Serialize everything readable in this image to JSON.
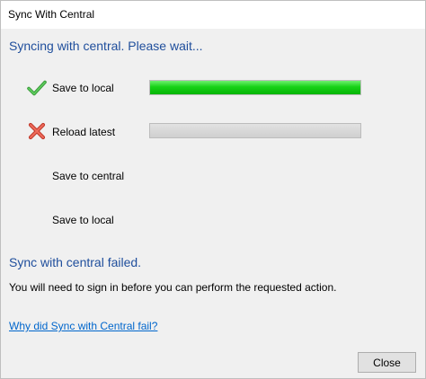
{
  "window": {
    "title": "Sync With Central"
  },
  "status": {
    "heading": "Syncing with central. Please wait..."
  },
  "steps": [
    {
      "label": "Save to local",
      "state": "success",
      "icon": "check-icon",
      "progress": 1.0
    },
    {
      "label": "Reload latest",
      "state": "failed",
      "icon": "x-mark-icon",
      "progress": 0.0
    },
    {
      "label": "Save to central",
      "state": "pending"
    },
    {
      "label": "Save to local",
      "state": "pending"
    }
  ],
  "result": {
    "title": "Sync with central failed.",
    "message": "You will need to sign in before you can perform the requested action.",
    "help_link": "Why did Sync with Central fail?"
  },
  "buttons": {
    "close": "Close"
  },
  "colors": {
    "heading": "#1f4e9c",
    "link": "#0066cc",
    "success": "#11c011",
    "error": "#e04a3c"
  }
}
